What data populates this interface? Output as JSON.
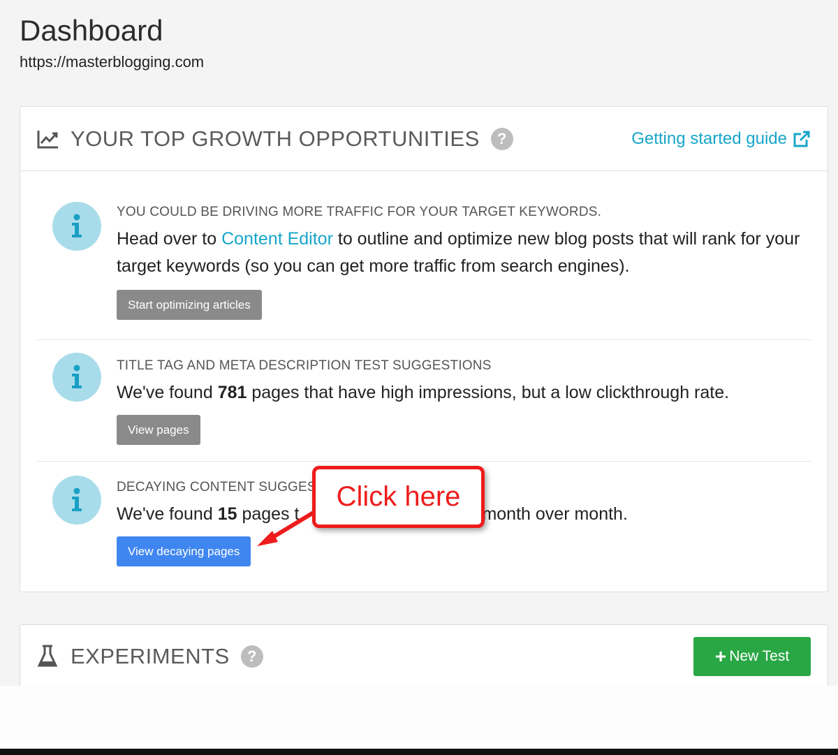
{
  "page": {
    "title": "Dashboard",
    "url": "https://masterblogging.com"
  },
  "growth": {
    "title": "YOUR TOP GROWTH OPPORTUNITIES",
    "guide_link": "Getting started guide",
    "opportunities": [
      {
        "heading": "YOU COULD BE DRIVING MORE TRAFFIC FOR YOUR TARGET KEYWORDS.",
        "text_before": "Head over to ",
        "link_text": "Content Editor",
        "text_after": " to outline and optimize new blog posts that will rank for your target keywords (so you can get more traffic from search engines).",
        "button": "Start optimizing articles"
      },
      {
        "heading": "TITLE TAG AND META DESCRIPTION TEST SUGGESTIONS",
        "text_before": "We've found ",
        "count": "781",
        "text_after": " pages that have high impressions, but a low clickthrough rate.",
        "button": "View pages"
      },
      {
        "heading": "DECAYING CONTENT SUGGES",
        "text_before": "We've found ",
        "count": "15",
        "text_mid": " pages t",
        "text_after": "month over month.",
        "button": "View decaying pages"
      }
    ]
  },
  "callout": {
    "text": "Click here"
  },
  "experiments": {
    "title": "EXPERIMENTS",
    "new_test_button": "New Test"
  },
  "colors": {
    "link": "#17a6c9",
    "primary_button": "#3f86f0",
    "secondary_button": "#8a8a8a",
    "success_button": "#2aa745",
    "callout": "#ee1c1c",
    "info_icon_bg": "#a9dcea"
  }
}
